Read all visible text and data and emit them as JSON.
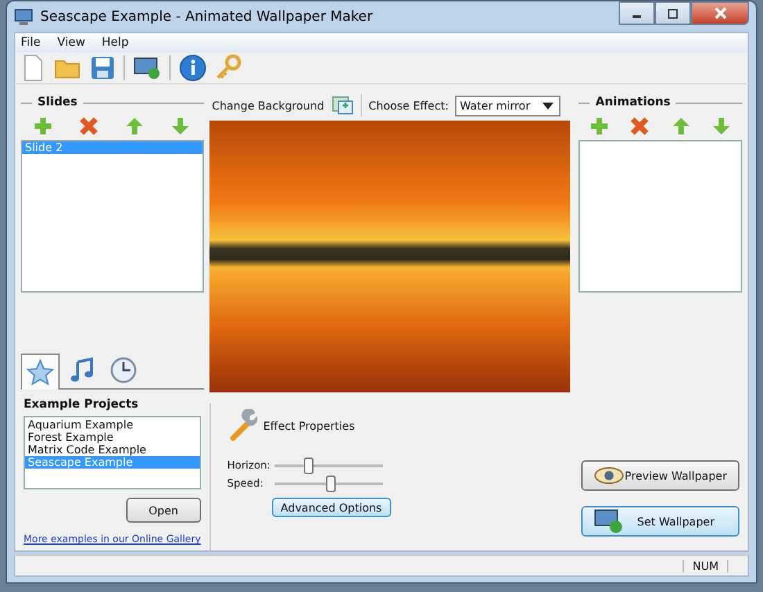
{
  "window": {
    "title": "Seascape Example - Animated Wallpaper Maker"
  },
  "menu": [
    "File",
    "View",
    "Help"
  ],
  "slides": {
    "title": "Slides",
    "items": [
      {
        "label": "Slide 2",
        "selected": true
      }
    ]
  },
  "tabs": [
    {
      "kind": "star",
      "selected": true
    },
    {
      "kind": "music",
      "selected": false
    },
    {
      "kind": "clock",
      "selected": false
    }
  ],
  "examples": {
    "title": "Example Projects",
    "items": [
      {
        "label": "Aquarium Example",
        "selected": false
      },
      {
        "label": "Forest Example",
        "selected": false
      },
      {
        "label": "Matrix Code Example",
        "selected": false
      },
      {
        "label": "Seascape Example",
        "selected": true
      }
    ],
    "open_button": "Open",
    "gallery_link": "More examples in our Online Gallery"
  },
  "background_button": "Change Background",
  "effect": {
    "label": "Choose Effect:",
    "value": "Water mirror"
  },
  "properties": {
    "title": "Effect Properties",
    "sliders": [
      {
        "label": "Horizon:",
        "level": 0.3
      },
      {
        "label": "Speed:",
        "level": 0.5
      }
    ],
    "advanced_button": "Advanced Options"
  },
  "animations": {
    "title": "Animations"
  },
  "preview_button": "Preview Wallpaper",
  "set_button": "Set Wallpaper",
  "status_bar": {
    "num": "NUM"
  }
}
